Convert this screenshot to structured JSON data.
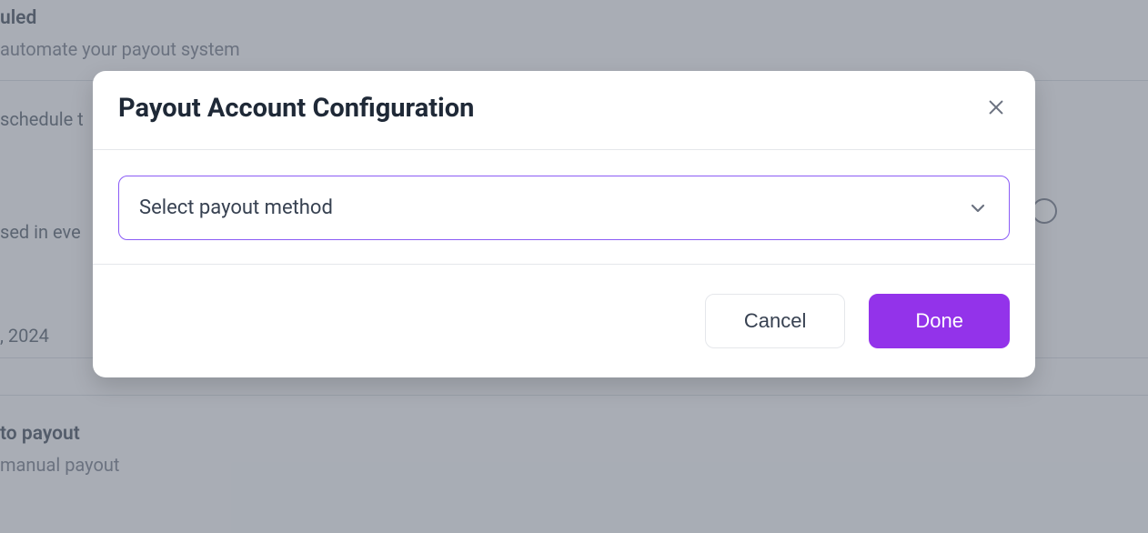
{
  "background": {
    "section1": {
      "title_fragment": "uled",
      "subtitle_fragment": "automate your payout system"
    },
    "section2": {
      "text_fragment": "schedule t"
    },
    "section3": {
      "text_fragment": "sed in eve",
      "date_fragment": ", 2024"
    },
    "section4": {
      "title_fragment": "to payout",
      "subtitle_fragment": "manual payout"
    }
  },
  "modal": {
    "title": "Payout Account Configuration",
    "select_placeholder": "Select payout method",
    "cancel_label": "Cancel",
    "done_label": "Done"
  }
}
